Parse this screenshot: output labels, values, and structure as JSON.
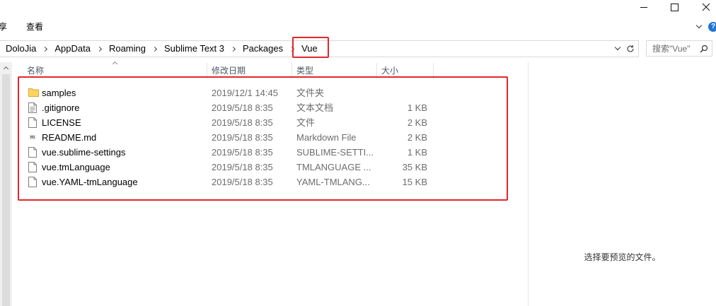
{
  "window": {
    "minimize_icon": "minimize-icon",
    "maximize_icon": "maximize-icon",
    "close_icon": "close-icon"
  },
  "ribbon": {
    "tabs": [
      {
        "label": "享"
      },
      {
        "label": "查看"
      }
    ],
    "expand_icon": "chevron-down-icon",
    "help_icon": "help-icon"
  },
  "address_bar": {
    "breadcrumb": [
      {
        "label": "DoloJia"
      },
      {
        "label": "AppData"
      },
      {
        "label": "Roaming"
      },
      {
        "label": "Sublime Text 3"
      },
      {
        "label": "Packages"
      },
      {
        "label": "Vue",
        "highlighted": true
      }
    ],
    "separator_icon": "chevron-right-icon",
    "history_icon": "chevron-down-icon",
    "refresh_icon": "refresh-icon"
  },
  "search": {
    "placeholder": "搜索\"Vue\"",
    "icon": "search-icon"
  },
  "columns": [
    {
      "label": "名称",
      "sort_icon": "sort-ascending-icon"
    },
    {
      "label": "修改日期"
    },
    {
      "label": "类型"
    },
    {
      "label": "大小"
    }
  ],
  "files": [
    {
      "name": "samples",
      "modified": "2019/12/1 14:45",
      "type": "文件夹",
      "size": "",
      "icon": "folder-icon"
    },
    {
      "name": ".gitignore",
      "modified": "2019/5/18 8:35",
      "type": "文本文档",
      "size": "1 KB",
      "icon": "text-document-icon"
    },
    {
      "name": "LICENSE",
      "modified": "2019/5/18 8:35",
      "type": "文件",
      "size": "2 KB",
      "icon": "file-icon"
    },
    {
      "name": "README.md",
      "modified": "2019/5/18 8:35",
      "type": "Markdown File",
      "size": "2 KB",
      "icon": "markdown-file-icon"
    },
    {
      "name": "vue.sublime-settings",
      "modified": "2019/5/18 8:35",
      "type": "SUBLIME-SETTI...",
      "size": "1 KB",
      "icon": "file-icon"
    },
    {
      "name": "vue.tmLanguage",
      "modified": "2019/5/18 8:35",
      "type": "TMLANGUAGE ...",
      "size": "35 KB",
      "icon": "file-icon"
    },
    {
      "name": "vue.YAML-tmLanguage",
      "modified": "2019/5/18 8:35",
      "type": "YAML-TMLANG...",
      "size": "15 KB",
      "icon": "file-icon"
    }
  ],
  "preview": {
    "message": "选择要预览的文件。"
  },
  "colors": {
    "highlight": "#e3262b",
    "folder": "#ffd45c",
    "secondary_text": "#6d6d6d",
    "accent": "#1f76d2"
  }
}
